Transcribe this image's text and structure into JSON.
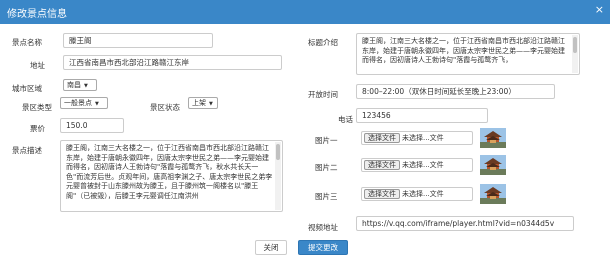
{
  "dialog": {
    "title": "修改景点信息",
    "close_icon": "×"
  },
  "form": {
    "name_label": "景点名称",
    "name_value": "滕王阁",
    "address_label": "地址",
    "address_value": "江西省南昌市西北部沿江路赣江东岸",
    "city_label": "城市区域",
    "city_value": "南昌",
    "type_label": "景区类型",
    "type_value": "一般景点",
    "status_label": "景区状态",
    "status_value": "上架",
    "price_label": "票价",
    "price_value": "150.0",
    "desc_label": "景点描述",
    "desc_value": "滕王阁，江南三大名楼之一，位于江西省南昌市西北部沿江路赣江东岸，始建于唐朝永徽四年，因唐太宗李世民之弟——李元婴始建而得名，因初唐诗人王勃诗句\"落霞与孤鹜齐飞，秋水共长天一色\"而流芳后世。贞观年间，唐高祖李渊之子、唐太宗李世民之弟李元婴曾被封于山东滕州故为滕王，且于滕州筑一阁楼名以\"滕王阁\"（已被毁），后滕王李元婴调任江南洪州",
    "title_intro_label": "标题介绍",
    "title_intro_value": "滕王阁，江南三大名楼之一，位于江西省南昌市西北部沿江路赣江东岸，始建于唐朝永徽四年，因唐太宗李世民之弟——李元婴始建而得名，因初唐诗人王勃诗句\"落霞与孤鹜齐飞，",
    "hours_label": "开放时间",
    "hours_value": "8:00–22:00（双休日时间延长至晚上23:00）",
    "phone_label": "电话",
    "phone_value": "123456",
    "image1_label": "图片一",
    "image2_label": "图片二",
    "image3_label": "图片三",
    "file_button": "选择文件",
    "file_placeholder": "未选择...文件",
    "video_label": "视频地址",
    "video_value": "https://v.qq.com/iframe/player.html?vid=n0344d5v"
  },
  "footer": {
    "close_label": "关闭",
    "submit_label": "提交更改"
  },
  "colors": {
    "header_bg": "#3a87c8",
    "submit_bg": "#3a87c8"
  },
  "icons": {
    "close": "close-icon",
    "select_arrow": "chevron-down-icon",
    "thumbnail": "pavilion-image"
  }
}
